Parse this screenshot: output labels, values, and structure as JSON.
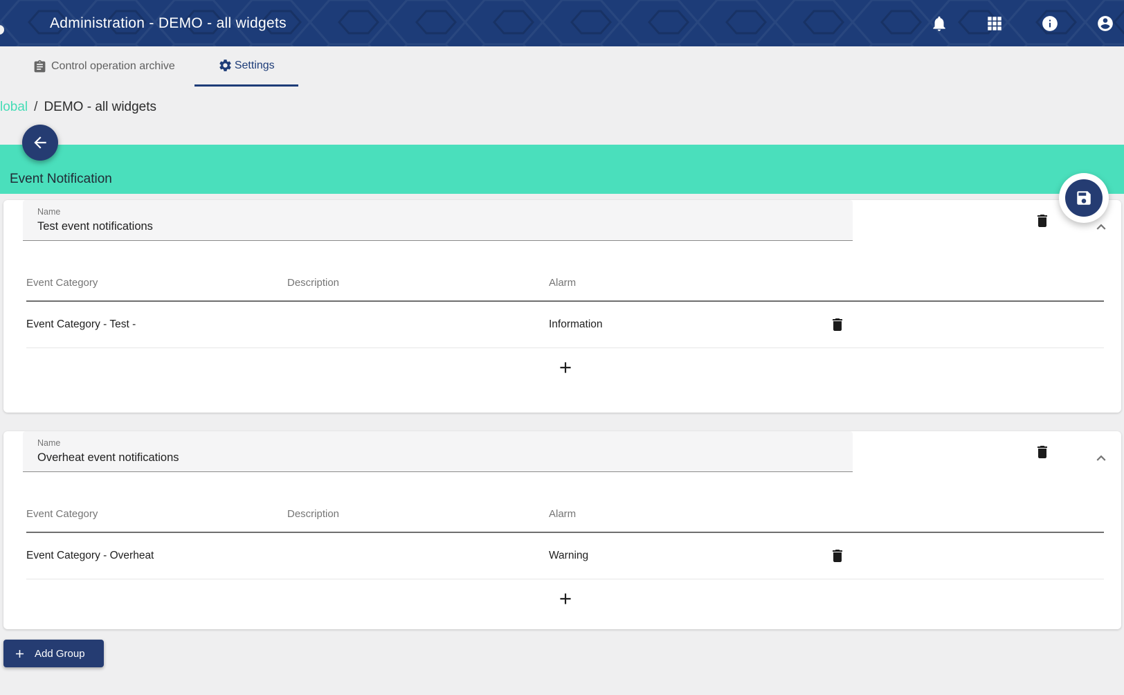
{
  "header": {
    "title": "Administration - DEMO - all widgets"
  },
  "tabs": {
    "archive": "Control operation archive",
    "settings": "Settings"
  },
  "breadcrumb": {
    "root": "lobal",
    "separator": "/",
    "current": "DEMO - all widgets"
  },
  "banner": {
    "title": "Event Notification"
  },
  "columns": {
    "event_category": "Event Category",
    "description": "Description",
    "alarm": "Alarm"
  },
  "groups": [
    {
      "name_label": "Name",
      "name_value": "Test event notifications",
      "rows": [
        {
          "event_category": "Event Category - Test -",
          "description": "",
          "alarm": "Information"
        }
      ]
    },
    {
      "name_label": "Name",
      "name_value": "Overheat event notifications",
      "rows": [
        {
          "event_category": "Event Category - Overheat",
          "description": "",
          "alarm": "Warning"
        }
      ]
    }
  ],
  "buttons": {
    "add_group": "Add Group"
  },
  "icons": {
    "top_right": [
      "bell-icon",
      "apps-grid-icon",
      "info-icon",
      "account-icon"
    ],
    "tab_icons": [
      "clipboard-icon",
      "gear-icon"
    ],
    "actions": [
      "back-arrow-icon",
      "save-icon",
      "trash-icon",
      "chevron-up-icon",
      "plus-icon"
    ]
  },
  "colors": {
    "navy": "#1d3c78",
    "navy_button": "#253c72",
    "teal_banner": "#4adfbc",
    "teal_link": "#45dcb6",
    "page_bg": "#efeff0",
    "field_bg": "#f5f5f6",
    "text_primary": "#1f1f1f",
    "text_secondary": "#757575"
  }
}
